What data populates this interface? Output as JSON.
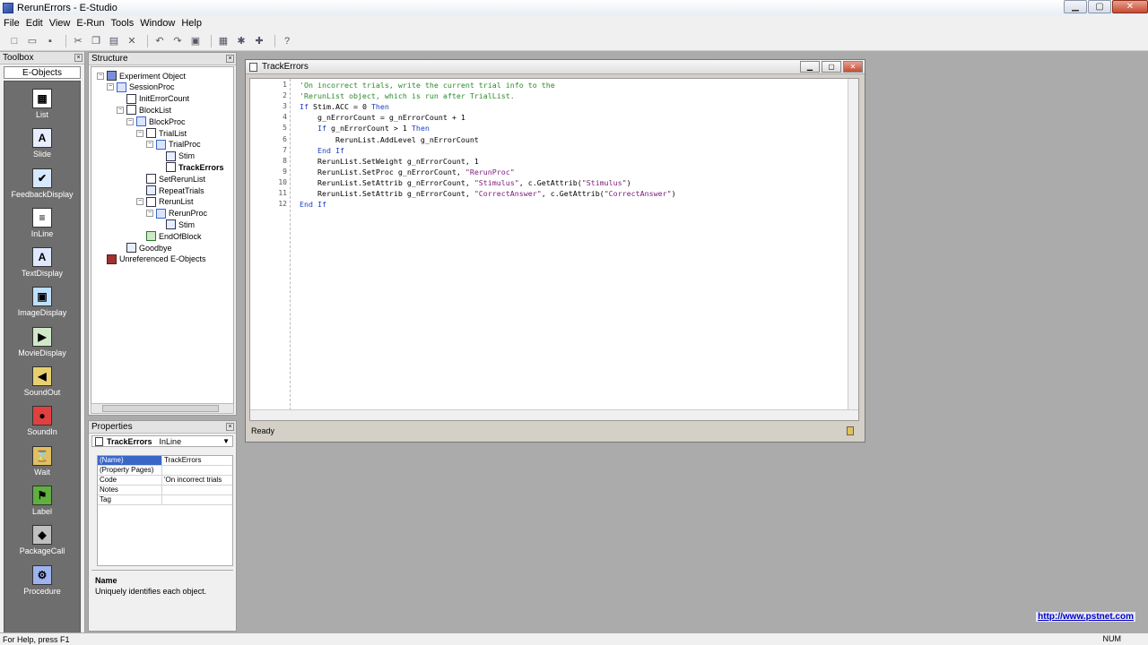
{
  "window": {
    "title": "RerunErrors - E-Studio"
  },
  "menu": [
    "File",
    "Edit",
    "View",
    "E-Run",
    "Tools",
    "Window",
    "Help"
  ],
  "toolbox": {
    "header": "Toolbox",
    "tab": "E-Objects",
    "tools": [
      {
        "label": "List",
        "icon": "list-icon",
        "glyph": "▦",
        "bg": "#ffffff"
      },
      {
        "label": "Slide",
        "icon": "slide-icon",
        "glyph": "A",
        "bg": "#e8eeff"
      },
      {
        "label": "FeedbackDisplay",
        "icon": "feedback-icon",
        "glyph": "✔",
        "bg": "#d8e8ff"
      },
      {
        "label": "InLine",
        "icon": "inline-icon",
        "glyph": "≡",
        "bg": "#ffffff"
      },
      {
        "label": "TextDisplay",
        "icon": "textdisplay-icon",
        "glyph": "A",
        "bg": "#dfe8ff"
      },
      {
        "label": "ImageDisplay",
        "icon": "imagedisplay-icon",
        "glyph": "▣",
        "bg": "#bfe0ff"
      },
      {
        "label": "MovieDisplay",
        "icon": "moviedisplay-icon",
        "glyph": "▶",
        "bg": "#d0e8c8"
      },
      {
        "label": "SoundOut",
        "icon": "soundout-icon",
        "glyph": "◀",
        "bg": "#e8d070"
      },
      {
        "label": "SoundIn",
        "icon": "soundin-icon",
        "glyph": "●",
        "bg": "#e04040"
      },
      {
        "label": "Wait",
        "icon": "wait-icon",
        "glyph": "⌛",
        "bg": "#e0c060"
      },
      {
        "label": "Label",
        "icon": "label-icon",
        "glyph": "⚑",
        "bg": "#60b040"
      },
      {
        "label": "PackageCall",
        "icon": "packagecall-icon",
        "glyph": "◆",
        "bg": "#c0c0c0"
      },
      {
        "label": "Procedure",
        "icon": "procedure-icon",
        "glyph": "⚙",
        "bg": "#9fb2f0"
      }
    ]
  },
  "structure": {
    "header": "Structure",
    "nodes": [
      {
        "label": "Experiment Object",
        "depth": 0,
        "icon": "exp",
        "exp": "−"
      },
      {
        "label": "SessionProc",
        "depth": 1,
        "icon": "proc",
        "exp": "−"
      },
      {
        "label": "InitErrorCount",
        "depth": 2,
        "icon": "inline",
        "exp": ""
      },
      {
        "label": "BlockList",
        "depth": 2,
        "icon": "list",
        "exp": "−"
      },
      {
        "label": "BlockProc",
        "depth": 3,
        "icon": "proc",
        "exp": "−"
      },
      {
        "label": "TrialList",
        "depth": 4,
        "icon": "list",
        "exp": "−"
      },
      {
        "label": "TrialProc",
        "depth": 5,
        "icon": "proc",
        "exp": "−"
      },
      {
        "label": "Stim",
        "depth": 6,
        "icon": "text",
        "exp": ""
      },
      {
        "label": "TrackErrors",
        "depth": 6,
        "icon": "inline",
        "exp": "",
        "bold": true
      },
      {
        "label": "SetRerunList",
        "depth": 4,
        "icon": "inline",
        "exp": ""
      },
      {
        "label": "RepeatTrials",
        "depth": 4,
        "icon": "text",
        "exp": ""
      },
      {
        "label": "RerunList",
        "depth": 4,
        "icon": "list",
        "exp": "−"
      },
      {
        "label": "RerunProc",
        "depth": 5,
        "icon": "proc",
        "exp": "−"
      },
      {
        "label": "Stim",
        "depth": 6,
        "icon": "text",
        "exp": ""
      },
      {
        "label": "EndOfBlock",
        "depth": 4,
        "icon": "label",
        "exp": ""
      },
      {
        "label": "Goodbye",
        "depth": 2,
        "icon": "text",
        "exp": ""
      },
      {
        "label": "Unreferenced E-Objects",
        "depth": 0,
        "icon": "unref",
        "exp": ""
      }
    ]
  },
  "properties": {
    "header": "Properties",
    "object_name": "TrackErrors",
    "object_type": "InLine",
    "rows": [
      {
        "key": "(Name)",
        "value": "TrackErrors"
      },
      {
        "key": "(Property Pages)",
        "value": ""
      },
      {
        "key": "Code",
        "value": "'On incorrect trials"
      },
      {
        "key": "Notes",
        "value": ""
      },
      {
        "key": "Tag",
        "value": ""
      }
    ],
    "desc_name": "Name",
    "desc_text": "Uniquely identifies each object."
  },
  "editor": {
    "title": "TrackErrors",
    "status": "Ready",
    "lines": [
      {
        "n": "1",
        "text": "'On incorrect trials, write the current trial info to the",
        "comment": true
      },
      {
        "n": "2",
        "text": "'RerunList object, which is run after TrialList.",
        "comment": true
      },
      {
        "n": "3",
        "text": "If Stim.ACC = 0 Then"
      },
      {
        "n": "4",
        "text": "    g_nErrorCount = g_nErrorCount + 1"
      },
      {
        "n": "5",
        "text": "    If g_nErrorCount > 1 Then"
      },
      {
        "n": "6",
        "text": "        RerunList.AddLevel g_nErrorCount"
      },
      {
        "n": "7",
        "text": "    End If"
      },
      {
        "n": "8",
        "text": "    RerunList.SetWeight g_nErrorCount, 1"
      },
      {
        "n": "9",
        "text": "    RerunList.SetProc g_nErrorCount, \"RerunProc\""
      },
      {
        "n": "10",
        "text": "    RerunList.SetAttrib g_nErrorCount, \"Stimulus\", c.GetAttrib(\"Stimulus\")"
      },
      {
        "n": "11",
        "text": "    RerunList.SetAttrib g_nErrorCount, \"CorrectAnswer\", c.GetAttrib(\"CorrectAnswer\")"
      },
      {
        "n": "12",
        "text": "End If"
      }
    ]
  },
  "statusbar": {
    "help": "For Help, press F1",
    "num": "NUM"
  },
  "weblink": "http://www.pstnet.com"
}
